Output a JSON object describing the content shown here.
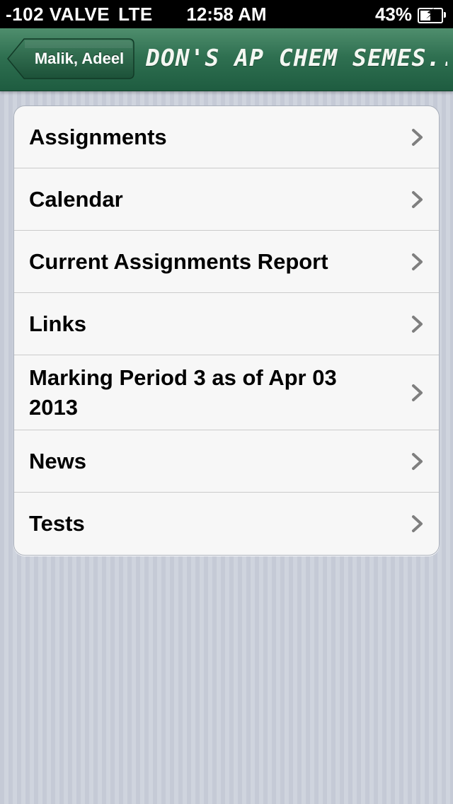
{
  "status_bar": {
    "carrier": "-102 VALVE",
    "network": "LTE",
    "time": "12:58 AM",
    "battery_percent": "43%",
    "battery_level": 0.43
  },
  "nav": {
    "back_label": "Malik, Adeel",
    "title": "DON'S AP CHEM SEMES..."
  },
  "menu": {
    "items": [
      {
        "label": "Assignments"
      },
      {
        "label": "Calendar"
      },
      {
        "label": "Current Assignments Report"
      },
      {
        "label": "Links"
      },
      {
        "label": "Marking Period 3 as of Apr 03 2013"
      },
      {
        "label": "News"
      },
      {
        "label": "Tests"
      }
    ]
  },
  "colors": {
    "nav_green": "#2f7051",
    "background": "#c9ced9",
    "chevron": "#7f7f7f"
  },
  "icons": {
    "disclosure": "chevron-right-icon",
    "back": "back-arrow-icon",
    "battery": "battery-charging-icon"
  }
}
